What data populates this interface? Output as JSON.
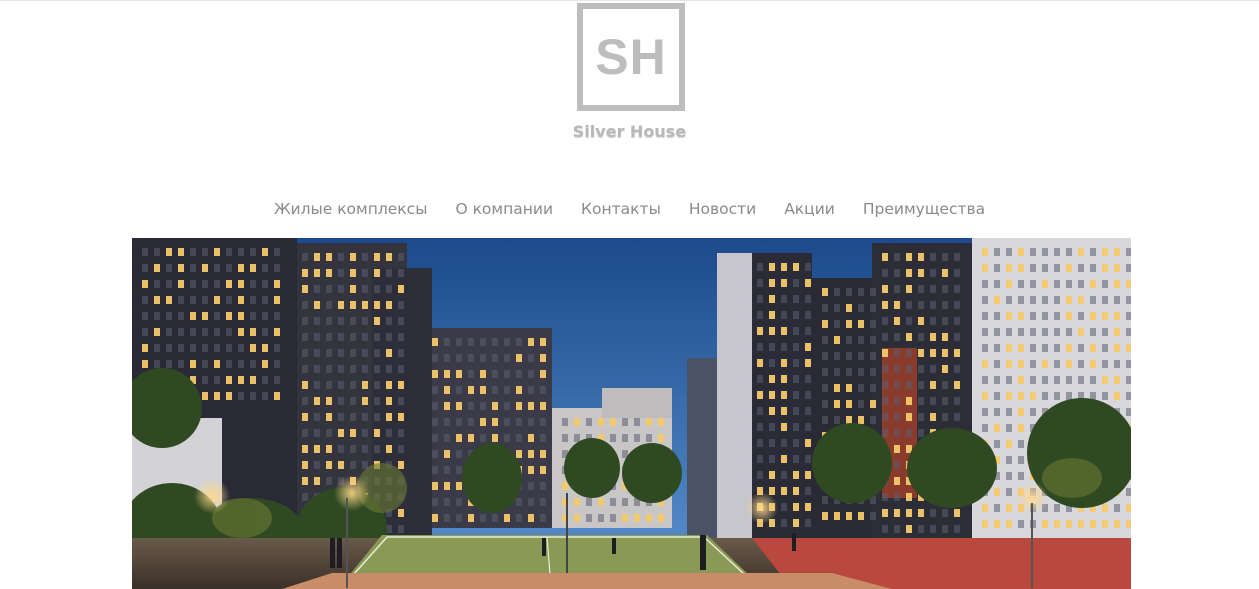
{
  "logo": {
    "letters": "SH",
    "name": "Silver House"
  },
  "nav": {
    "items": [
      "Жилые комплексы",
      "О компании",
      "Контакты",
      "Новости",
      "Акции",
      "Преимущества"
    ]
  },
  "colors": {
    "logo_gray": "#bdbdbd",
    "nav_text": "#8a8a8a",
    "sky_top": "#1f4e8f",
    "sky_bottom": "#3f7fc4",
    "building_dark": "#2b2b38",
    "building_light": "#cfcfd6",
    "window_lit": "#f6c96b",
    "court_green": "#8a9a55",
    "track_red": "#b9483e"
  }
}
